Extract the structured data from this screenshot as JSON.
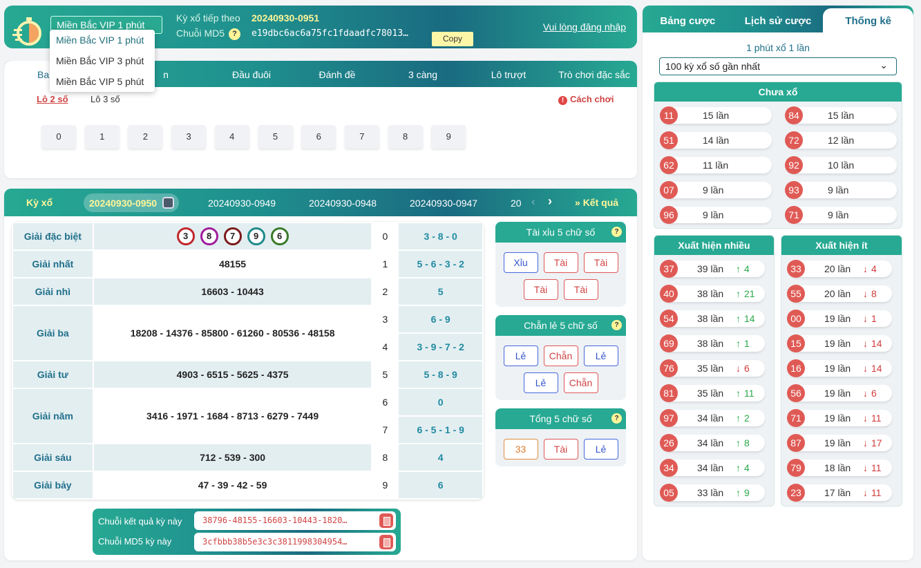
{
  "header": {
    "region_selected": "Miền Bắc VIP 1 phút",
    "region_options": [
      "Miền Bắc VIP 1 phút",
      "Miền Bắc VIP 3 phút",
      "Miền Bắc VIP 5 phút"
    ],
    "next_draw_label": "Kỳ xổ tiếp theo",
    "next_draw": "20240930-0951",
    "md5_label": "Chuỗi MD5",
    "md5": "e19dbc6ac6a75fc1fdaadfc78013…",
    "copy": "Copy",
    "login": "Vui lòng đăng nhập"
  },
  "game": {
    "tabs": [
      "Ba",
      "n",
      "Đầu đuôi",
      "Đánh đề",
      "3 càng",
      "Lô trượt",
      "Trò chơi đặc sắc"
    ],
    "subtabs": [
      "Lô 2 số",
      "Lô 3 số"
    ],
    "how_to": "Cách chơi",
    "numbers": [
      "0",
      "1",
      "2",
      "3",
      "4",
      "5",
      "6",
      "7",
      "8",
      "9"
    ]
  },
  "draws": {
    "label": "Kỳ xổ",
    "items": [
      "20240930-0950",
      "20240930-0949",
      "20240930-0948",
      "20240930-0947",
      "20"
    ],
    "results_link": "Kết quả"
  },
  "special_balls": [
    {
      "v": "3",
      "color": "#c0272d"
    },
    {
      "v": "8",
      "color": "#a01c9c"
    },
    {
      "v": "7",
      "color": "#7a1a1a"
    },
    {
      "v": "9",
      "color": "#1f8a8a"
    },
    {
      "v": "6",
      "color": "#3a7a2a"
    }
  ],
  "prizes": [
    {
      "label": "Giải đặc biệt",
      "value": ""
    },
    {
      "label": "Giải nhất",
      "value": "48155"
    },
    {
      "label": "Giải nhì",
      "value": "16603 - 10443"
    },
    {
      "label": "Giải ba",
      "value": "18208 - 14376 - 85800 - 61260 - 80536 - 48158"
    },
    {
      "label": "Giải tư",
      "value": "4903 - 6515 - 5625 - 4375"
    },
    {
      "label": "Giải năm",
      "value": "3416 - 1971 - 1684 - 8713 - 6279 - 7449"
    },
    {
      "label": "Giải sáu",
      "value": "712 - 539 - 300"
    },
    {
      "label": "Giải bảy",
      "value": "47 - 39 - 42 - 59"
    }
  ],
  "tails": [
    {
      "d": "0",
      "t": "3 - 8 - 0"
    },
    {
      "d": "1",
      "t": "5 - 6 - 3 - 2"
    },
    {
      "d": "2",
      "t": "5"
    },
    {
      "d": "3",
      "t": "6 - 9"
    },
    {
      "d": "4",
      "t": "3 - 9 - 7 - 2"
    },
    {
      "d": "5",
      "t": "5 - 8 - 9"
    },
    {
      "d": "6",
      "t": "0"
    },
    {
      "d": "7",
      "t": "6 - 5 - 1 - 9"
    },
    {
      "d": "8",
      "t": "4"
    },
    {
      "d": "9",
      "t": "6"
    }
  ],
  "side": [
    {
      "title": "Tài xỉu 5 chữ số",
      "chips": [
        {
          "t": "Xỉu",
          "c": "blue"
        },
        {
          "t": "Tài",
          "c": "red"
        },
        {
          "t": "Tài",
          "c": "red"
        },
        {
          "t": "Tài",
          "c": "red"
        },
        {
          "t": "Tài",
          "c": "red"
        }
      ]
    },
    {
      "title": "Chẵn lẻ 5 chữ số",
      "chips": [
        {
          "t": "Lẻ",
          "c": "blue"
        },
        {
          "t": "Chẵn",
          "c": "red"
        },
        {
          "t": "Lẻ",
          "c": "blue"
        },
        {
          "t": "Lẻ",
          "c": "blue"
        },
        {
          "t": "Chẵn",
          "c": "red"
        }
      ]
    },
    {
      "title": "Tổng 5 chữ số",
      "chips": [
        {
          "t": "33",
          "c": "org"
        },
        {
          "t": "Tài",
          "c": "red"
        },
        {
          "t": "Lẻ",
          "c": "blue"
        }
      ]
    }
  ],
  "strings": {
    "result_label": "Chuỗi kết quả kỳ này",
    "result": "38796-48155-16603-10443-1820…",
    "md5_label": "Chuỗi MD5 kỳ này",
    "md5": "3cfbbb38b5e3c3c3811998304954…"
  },
  "stats": {
    "tabs": [
      "Bảng cược",
      "Lịch sử cược",
      "Thống kê"
    ],
    "subtitle": "1 phút xổ 1 lần",
    "range": "100 kỳ xổ số gần nhất",
    "not_drawn": {
      "title": "Chưa xổ",
      "items": [
        {
          "n": "11",
          "c": "15 lần"
        },
        {
          "n": "84",
          "c": "15 lần"
        },
        {
          "n": "51",
          "c": "14 lần"
        },
        {
          "n": "72",
          "c": "12 lần"
        },
        {
          "n": "62",
          "c": "11 lần"
        },
        {
          "n": "92",
          "c": "10 lần"
        },
        {
          "n": "07",
          "c": "9 lần"
        },
        {
          "n": "93",
          "c": "9 lần"
        },
        {
          "n": "96",
          "c": "9 lần"
        },
        {
          "n": "71",
          "c": "9 lần"
        }
      ]
    },
    "frequent": {
      "title": "Xuất hiện nhiều",
      "items": [
        {
          "n": "37",
          "c": "39 lần",
          "d": "up",
          "v": "4"
        },
        {
          "n": "40",
          "c": "38 lần",
          "d": "up",
          "v": "21"
        },
        {
          "n": "54",
          "c": "38 lần",
          "d": "up",
          "v": "14"
        },
        {
          "n": "69",
          "c": "38 lần",
          "d": "up",
          "v": "1"
        },
        {
          "n": "76",
          "c": "35 lần",
          "d": "down",
          "v": "6"
        },
        {
          "n": "81",
          "c": "35 lần",
          "d": "up",
          "v": "11"
        },
        {
          "n": "97",
          "c": "34 lần",
          "d": "up",
          "v": "2"
        },
        {
          "n": "26",
          "c": "34 lần",
          "d": "up",
          "v": "8"
        },
        {
          "n": "34",
          "c": "34 lần",
          "d": "up",
          "v": "4"
        },
        {
          "n": "05",
          "c": "33 lần",
          "d": "up",
          "v": "9"
        }
      ]
    },
    "rare": {
      "title": "Xuất hiện ít",
      "items": [
        {
          "n": "33",
          "c": "20 lần",
          "d": "down",
          "v": "4"
        },
        {
          "n": "55",
          "c": "20 lần",
          "d": "down",
          "v": "8"
        },
        {
          "n": "00",
          "c": "19 lần",
          "d": "down",
          "v": "1"
        },
        {
          "n": "15",
          "c": "19 lần",
          "d": "down",
          "v": "14"
        },
        {
          "n": "16",
          "c": "19 lần",
          "d": "down",
          "v": "14"
        },
        {
          "n": "56",
          "c": "19 lần",
          "d": "down",
          "v": "6"
        },
        {
          "n": "71",
          "c": "19 lần",
          "d": "down",
          "v": "11"
        },
        {
          "n": "87",
          "c": "19 lần",
          "d": "down",
          "v": "17"
        },
        {
          "n": "79",
          "c": "18 lần",
          "d": "down",
          "v": "11"
        },
        {
          "n": "23",
          "c": "17 lần",
          "d": "down",
          "v": "11"
        }
      ]
    }
  }
}
